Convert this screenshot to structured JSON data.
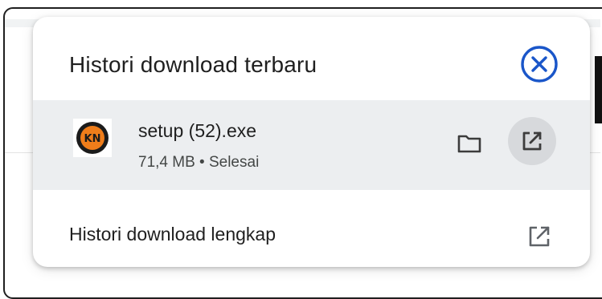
{
  "popup": {
    "title": "Histori download terbaru",
    "close_icon": "close-circle-icon",
    "accent_color": "#1a56c9"
  },
  "download": {
    "file_name": "setup (52).exe",
    "meta": "71,4 MB • Selesai",
    "file_icon": "app-logo-icon",
    "file_icon_text": "KN",
    "folder_icon": "folder-icon",
    "open_icon": "open-external-icon"
  },
  "footer": {
    "label": "Histori download lengkap",
    "icon": "open-external-icon"
  }
}
